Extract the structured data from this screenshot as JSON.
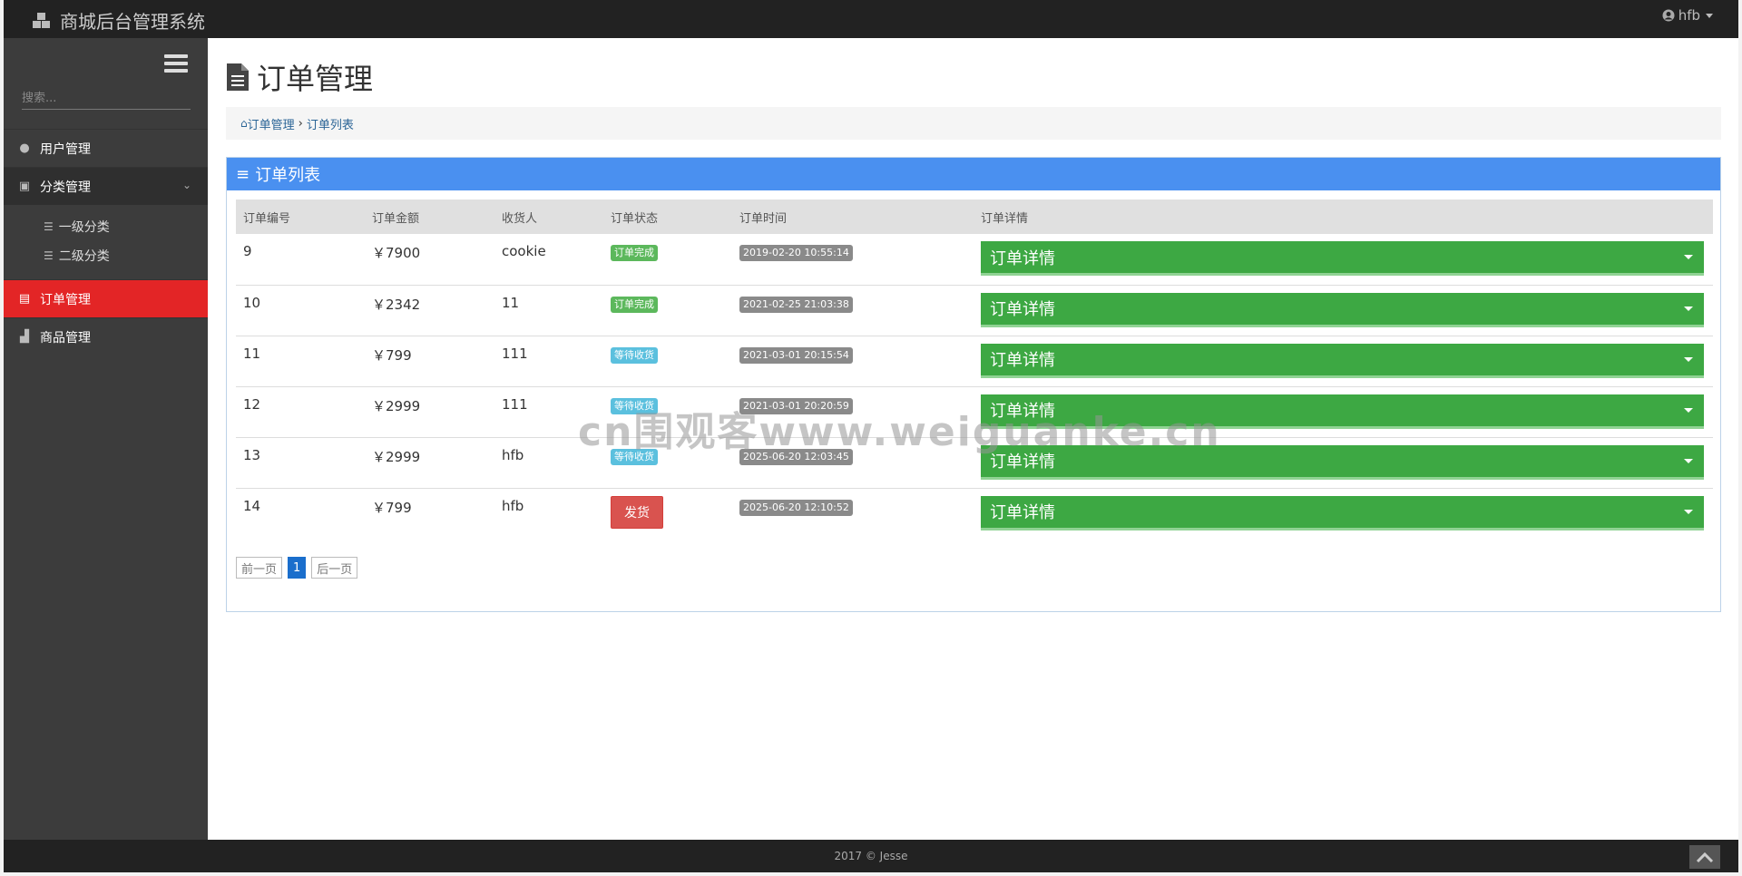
{
  "app": {
    "title": "商城后台管理系统",
    "user": "hfb"
  },
  "sidebar": {
    "search_placeholder": "搜索...",
    "items": [
      {
        "label": "用户管理"
      },
      {
        "label": "分类管理",
        "children": [
          "一级分类",
          "二级分类"
        ]
      },
      {
        "label": "订单管理"
      },
      {
        "label": "商品管理"
      }
    ]
  },
  "page": {
    "title": "订单管理",
    "breadcrumb": [
      "订单管理",
      "订单列表"
    ]
  },
  "panel": {
    "title": "订单列表",
    "columns": [
      "订单编号",
      "订单金额",
      "收货人",
      "订单状态",
      "订单时间",
      "订单详情"
    ],
    "rows": [
      {
        "id": "9",
        "amount": "￥7900",
        "receiver": "cookie",
        "status": "订单完成",
        "status_type": "done",
        "time": "2019-02-20 10:55:14",
        "detail": "订单详情"
      },
      {
        "id": "10",
        "amount": "￥2342",
        "receiver": "11",
        "status": "订单完成",
        "status_type": "done",
        "time": "2021-02-25 21:03:38",
        "detail": "订单详情"
      },
      {
        "id": "11",
        "amount": "￥799",
        "receiver": "111",
        "status": "等待收货",
        "status_type": "wait",
        "time": "2021-03-01 20:15:54",
        "detail": "订单详情"
      },
      {
        "id": "12",
        "amount": "￥2999",
        "receiver": "111",
        "status": "等待收货",
        "status_type": "wait",
        "time": "2021-03-01 20:20:59",
        "detail": "订单详情"
      },
      {
        "id": "13",
        "amount": "￥2999",
        "receiver": "hfb",
        "status": "等待收货",
        "status_type": "wait",
        "time": "2025-06-20 12:03:45",
        "detail": "订单详情"
      },
      {
        "id": "14",
        "amount": "￥799",
        "receiver": "hfb",
        "status": "发货",
        "status_type": "ship",
        "time": "2025-06-20 12:10:52",
        "detail": "订单详情"
      }
    ],
    "pager": {
      "prev": "前一页",
      "current": "1",
      "next": "后一页"
    }
  },
  "watermark": "cn围观客www.weiguanke.cn",
  "footer": "2017 © Jesse",
  "colors": {
    "topbar": "#222222",
    "sidebar": "#3c3c3c",
    "active": "#e32526",
    "panel_head": "#4a90f0",
    "detail_btn": "#3da843",
    "ship_btn": "#d9534f"
  }
}
